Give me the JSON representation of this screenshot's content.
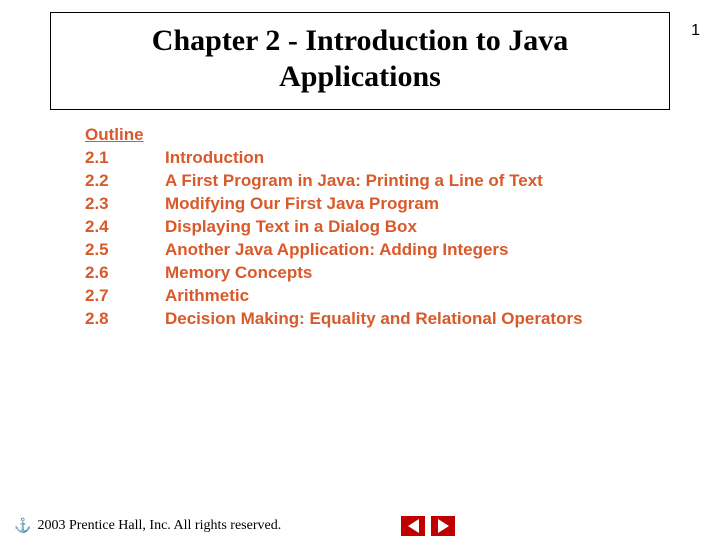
{
  "page_number": "1",
  "title": "Chapter 2 - Introduction to Java Applications",
  "outline": {
    "heading": "Outline",
    "items": [
      {
        "num": "2.1",
        "title": "Introduction"
      },
      {
        "num": "2.2",
        "title": "A First Program in Java: Printing a Line of Text"
      },
      {
        "num": "2.3",
        "title": "Modifying Our First Java Program"
      },
      {
        "num": "2.4",
        "title": "Displaying Text in a Dialog Box"
      },
      {
        "num": "2.5",
        "title": "Another Java Application: Adding Integers"
      },
      {
        "num": "2.6",
        "title": "Memory Concepts"
      },
      {
        "num": "2.7",
        "title": "Arithmetic"
      },
      {
        "num": "2.8",
        "title": "Decision Making: Equality and Relational  Operators"
      }
    ]
  },
  "footer": {
    "icon": "⚓",
    "copyright": "2003 Prentice Hall, Inc.  All rights reserved."
  }
}
